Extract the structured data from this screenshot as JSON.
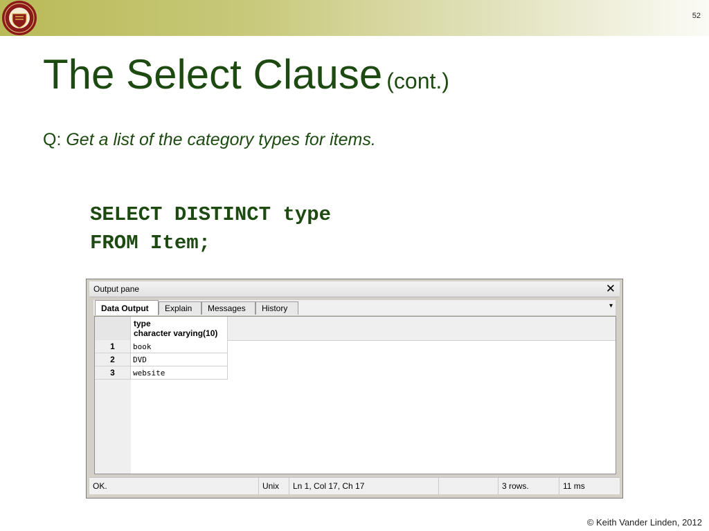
{
  "slide": {
    "number": "52",
    "title": "The Select Clause",
    "title_suffix": "(cont.)",
    "question_prefix": "Q:",
    "question_text": "Get a list of the category types for items.",
    "sql_line1": "SELECT DISTINCT type",
    "sql_line2": "FROM Item;",
    "footer": "© Keith Vander Linden, 2012"
  },
  "pane": {
    "title": "Output pane",
    "close_glyph": "✕",
    "tabs": [
      "Data Output",
      "Explain",
      "Messages",
      "History"
    ],
    "active_tab": "Data Output",
    "menu_glyph": "▾",
    "column": {
      "name": "type",
      "datatype": "character varying(10)"
    },
    "rows": [
      {
        "num": "1",
        "value": "book"
      },
      {
        "num": "2",
        "value": "DVD"
      },
      {
        "num": "3",
        "value": "website"
      }
    ],
    "status": {
      "message": "OK.",
      "line_ending": "Unix",
      "cursor": "Ln 1, Col 17, Ch 17",
      "rows": "3 rows.",
      "time": "11 ms"
    }
  },
  "colors": {
    "title_green": "#1c4a10",
    "logo_red": "#8b1a1a",
    "logo_gold": "#d9b24a"
  }
}
